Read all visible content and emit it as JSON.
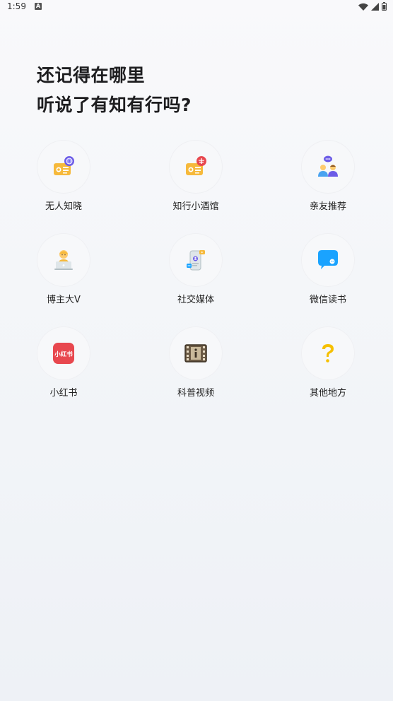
{
  "status_bar": {
    "time": "1:59",
    "app_indicator": "A"
  },
  "headline": {
    "line1": "还记得在哪里",
    "line2": "听说了有知有行吗?"
  },
  "options": [
    {
      "label": "无人知晓",
      "icon": "radio-podcast-icon"
    },
    {
      "label": "知行小酒馆",
      "icon": "radio-pub-icon"
    },
    {
      "label": "亲友推荐",
      "icon": "friends-chat-icon"
    },
    {
      "label": "博主大V",
      "icon": "blogger-laptop-icon"
    },
    {
      "label": "社交媒体",
      "icon": "social-phone-icon"
    },
    {
      "label": "微信读书",
      "icon": "wechat-read-icon"
    },
    {
      "label": "小红书",
      "icon": "xiaohongshu-icon"
    },
    {
      "label": "科普视频",
      "icon": "film-info-icon"
    },
    {
      "label": "其他地方",
      "icon": "question-mark-icon"
    }
  ],
  "xiaohongshu_logo_text": "小红书",
  "colors": {
    "accent_orange": "#f6b93b",
    "wechat_blue": "#1aa3ff",
    "xiaohongshu_red": "#e8474e",
    "purple": "#6c5ce7"
  }
}
